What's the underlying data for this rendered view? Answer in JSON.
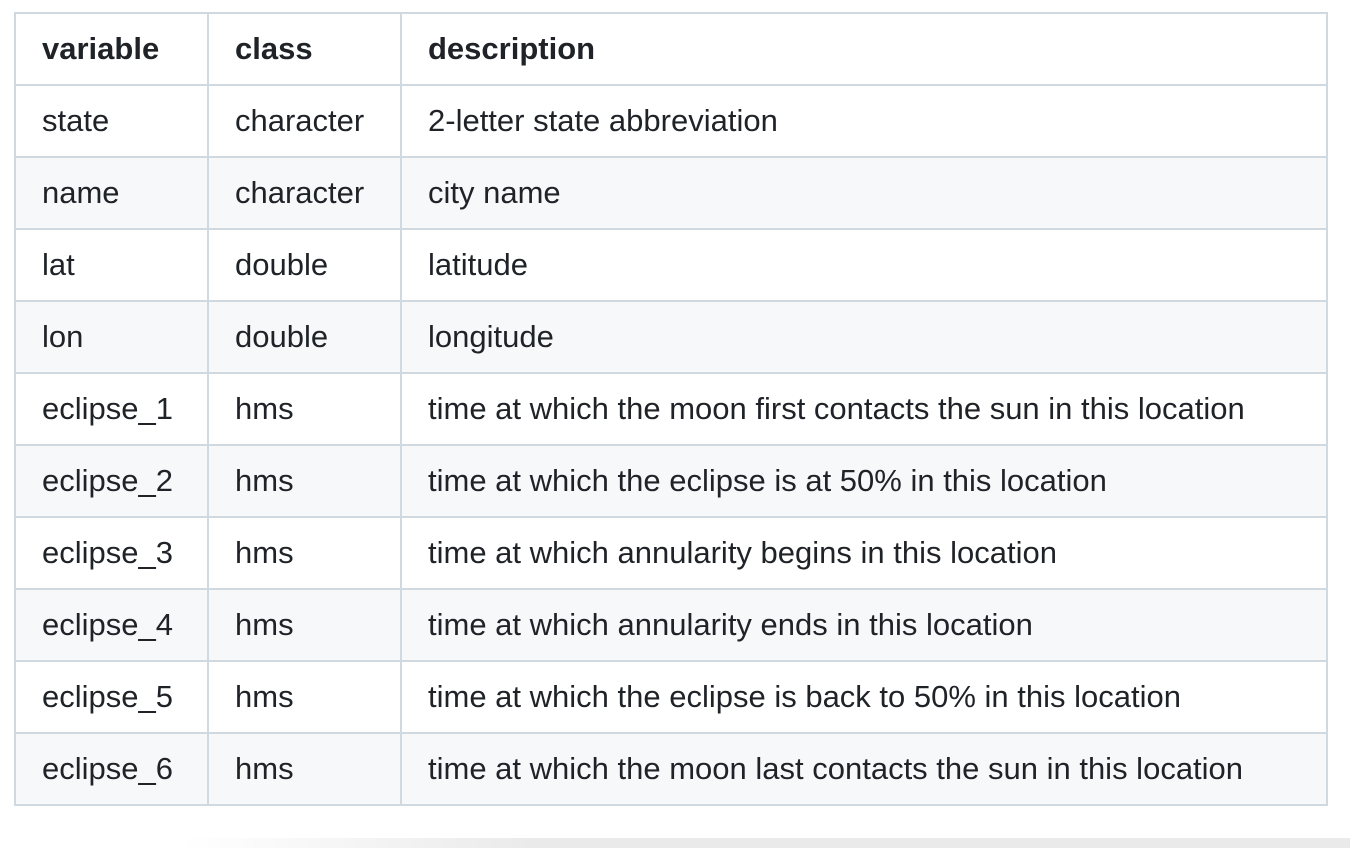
{
  "table": {
    "headers": [
      "variable",
      "class",
      "description"
    ],
    "rows": [
      [
        "state",
        "character",
        "2-letter state abbreviation"
      ],
      [
        "name",
        "character",
        "city name"
      ],
      [
        "lat",
        "double",
        "latitude"
      ],
      [
        "lon",
        "double",
        "longitude"
      ],
      [
        "eclipse_1",
        "hms",
        "time at which the moon first contacts the sun in this location"
      ],
      [
        "eclipse_2",
        "hms",
        "time at which the eclipse is at 50% in this location"
      ],
      [
        "eclipse_3",
        "hms",
        "time at which annularity begins in this location"
      ],
      [
        "eclipse_4",
        "hms",
        "time at which annularity ends in this location"
      ],
      [
        "eclipse_5",
        "hms",
        "time at which the eclipse is back to 50% in this location"
      ],
      [
        "eclipse_6",
        "hms",
        "time at which the moon last contacts the sun in this location"
      ]
    ]
  },
  "colors": {
    "border": "#d1d9e0",
    "row_alt_background": "#f6f8fa",
    "text": "#1f2328"
  }
}
